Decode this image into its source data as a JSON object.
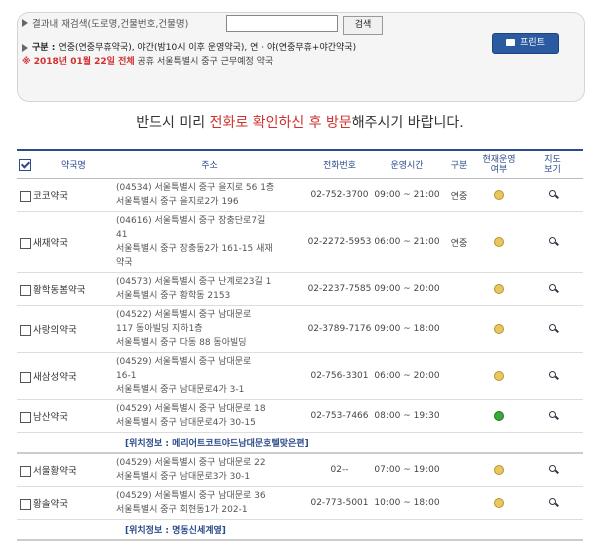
{
  "search": {
    "label": "결과내 재검색(도로명,건물번호,건물명)",
    "placeholder": "",
    "value": "",
    "button": "검색"
  },
  "legend": {
    "prefix": "구분 : ",
    "items": "연중(연중무휴약국), 야간(밤10시 이후 운영약국), 연 · 야(연중무휴+야간약국)"
  },
  "date_line": {
    "date": "2018년 01월 22일 전체",
    "rest": "공휴 서울특별시 중구  근무예정 약국"
  },
  "print_button": "프린트",
  "notice": {
    "pre": "반드시 미리 ",
    "highlight": "전화로 확인하신 후 방문",
    "post": "해주시기 바랍니다."
  },
  "columns": [
    "약국명",
    "주소",
    "전화번호",
    "운영시간",
    "구분",
    "현재운영\n여부",
    "지도\n보기"
  ],
  "rows": [
    {
      "name": "코코약국",
      "addr1": "(04534) 서울특별시 중구 을지로 56 1층",
      "addr2": "서울특별시 중구 을지로2가 196",
      "addr3": "",
      "phone": "02-752-3700",
      "hours": "09:00 ~ 21:00",
      "type": "연중",
      "status": "yellow"
    },
    {
      "name": "새재약국",
      "addr1": "(04616) 서울특별시 중구 장충단로7길",
      "addr2": "41",
      "addr3": "서울특별시 중구 장충동2가 161-15 새재",
      "addr4": "약국",
      "phone": "02-2272-5953",
      "hours": "06:00 ~ 21:00",
      "type": "연중",
      "status": "yellow"
    },
    {
      "name": "황학동봄약국",
      "addr1": "(04573) 서울특별시 중구 난계로23길 1",
      "addr2": "서울특별시 중구 황학동 2153",
      "addr3": "",
      "phone": "02-2237-7585",
      "hours": "09:00 ~ 20:00",
      "type": "",
      "status": "yellow"
    },
    {
      "name": "사랑의약국",
      "addr1": "(04522) 서울특별시 중구 남대문로",
      "addr2": "117 동아빌딩 지하1층",
      "addr3": "서울특별시 중구 다동 88 동아빌딩",
      "phone": "02-3789-7176",
      "hours": "09:00 ~ 18:00",
      "type": "",
      "status": "yellow"
    },
    {
      "name": "새삼성약국",
      "addr1": "(04529) 서울특별시 중구 남대문로",
      "addr2": "16-1",
      "addr3": "서울특별시 중구 남대문로4가 3-1",
      "phone": "02-756-3301",
      "hours": "06:00 ~ 20:00",
      "type": "",
      "status": "yellow"
    },
    {
      "name": "남산약국",
      "addr1": "(04529) 서울특별시 중구 남대문로 18",
      "addr2": "서울특별시 중구 남대문로4가 30-15",
      "addr3": "",
      "phone": "02-753-7466",
      "hours": "08:00 ~ 19:30",
      "type": "",
      "status": "green"
    },
    {
      "name": "서울황약국",
      "addr1": "(04529) 서울특별시 중구 남대문로 22",
      "addr2": "서울특별시 중구 남대문로3가 30-1",
      "addr3": "",
      "phone": "02--",
      "hours": "07:00 ~ 19:00",
      "type": "",
      "status": "yellow"
    },
    {
      "name": "황솔약국",
      "addr1": "(04529) 서울특별시 중구 남대문로 36",
      "addr2": "서울특별시 중구 회현동1가 202-1",
      "addr3": "",
      "phone": "02-773-5001",
      "hours": "10:00 ~ 18:00",
      "type": "",
      "status": "yellow"
    }
  ],
  "info_rows": [
    "[위치정보 : 메리어트코트야드남대문호텔맞은편]",
    "[위치정보 : 명동신세계옆]"
  ],
  "colors": {
    "accent": "#2c4b8a",
    "highlight": "#d0312d",
    "print": "#2c5aa0"
  }
}
